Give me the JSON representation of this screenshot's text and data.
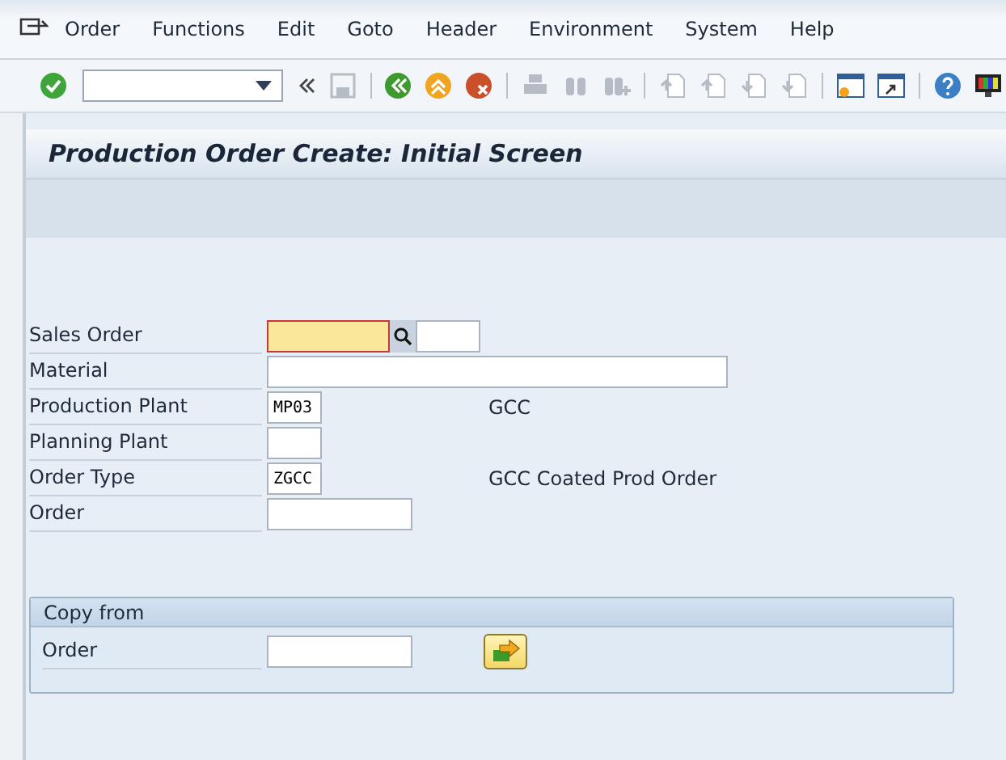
{
  "menu": [
    {
      "label": "Order"
    },
    {
      "label": "Functions"
    },
    {
      "label": "Edit"
    },
    {
      "label": "Goto"
    },
    {
      "label": "Header"
    },
    {
      "label": "Environment"
    },
    {
      "label": "System"
    },
    {
      "label": "Help"
    }
  ],
  "toolbar": [
    {
      "kind": "enter",
      "disabled": false
    },
    {
      "kind": "command",
      "disabled": false
    },
    {
      "kind": "collapse",
      "disabled": false
    },
    {
      "kind": "save",
      "disabled": true
    },
    {
      "kind": "sep"
    },
    {
      "kind": "back",
      "disabled": false
    },
    {
      "kind": "exit",
      "disabled": false
    },
    {
      "kind": "cancel",
      "disabled": false
    },
    {
      "kind": "sep"
    },
    {
      "kind": "print",
      "disabled": true
    },
    {
      "kind": "find",
      "disabled": true
    },
    {
      "kind": "findnext",
      "disabled": true
    },
    {
      "kind": "sep"
    },
    {
      "kind": "first",
      "disabled": true
    },
    {
      "kind": "prev",
      "disabled": true
    },
    {
      "kind": "next",
      "disabled": true
    },
    {
      "kind": "last",
      "disabled": true
    },
    {
      "kind": "sep"
    },
    {
      "kind": "newsession",
      "disabled": false
    },
    {
      "kind": "shortcut",
      "disabled": false
    },
    {
      "kind": "sep"
    },
    {
      "kind": "help",
      "disabled": false
    },
    {
      "kind": "layout",
      "disabled": false
    }
  ],
  "title": "Production Order Create: Initial Screen",
  "fields": [
    {
      "label": "Sales Order",
      "kind": "salesorder",
      "focused": true
    },
    {
      "label": "Material",
      "kind": "long",
      "focused": false
    },
    {
      "label": "Production Plant",
      "value": "MP03",
      "kind": "short",
      "description": "GCC",
      "focused": false
    },
    {
      "label": "Planning Plant",
      "kind": "short",
      "focused": false
    },
    {
      "label": "Order Type",
      "value": "ZGCC",
      "kind": "short",
      "description": "GCC Coated Prod Order",
      "focused": false
    },
    {
      "label": "Order",
      "kind": "medium",
      "focused": false
    }
  ],
  "copy_from": {
    "title": "Copy from",
    "label": "Order"
  }
}
